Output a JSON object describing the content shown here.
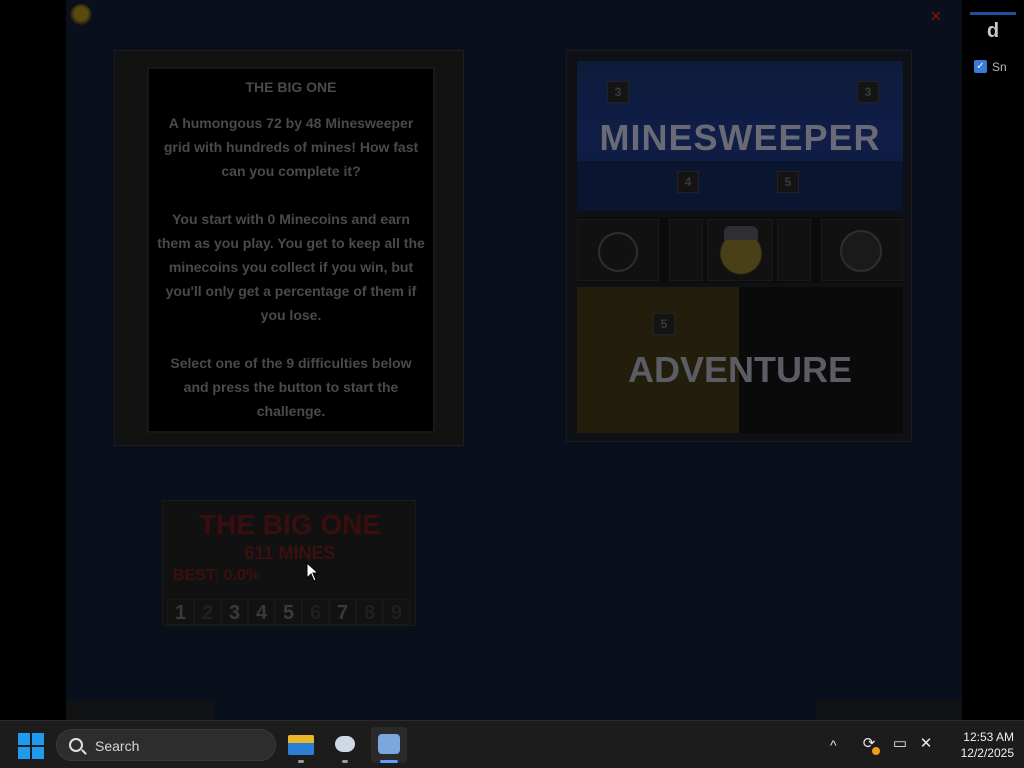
{
  "right_panel": {
    "letter": "d",
    "checkbox_label": "Sn"
  },
  "description": {
    "title": "THE BIG ONE",
    "paragraph1": "A humongous 72 by 48 Minesweeper grid with hundreds of mines! How fast can you complete it?",
    "paragraph2": "You start with 0 Minecoins and earn them as you play. You get to keep all the minecoins you collect if you win, but you'll only get a percentage of them if you lose.",
    "paragraph3": "Select one of the 9 difficulties below and press the button to start the challenge."
  },
  "title_image": {
    "title_top": "MINESWEEPER",
    "title_bottom": "ADVENTURE",
    "tile_numbers": [
      "3",
      "3",
      "4",
      "5",
      "5"
    ]
  },
  "selector": {
    "title": "THE BIG ONE",
    "mines_label": "611 MINES",
    "best_label": "BEST: 0.0%",
    "difficulties": [
      "1",
      "2",
      "3",
      "4",
      "5",
      "6",
      "7",
      "8",
      "9"
    ]
  },
  "taskbar": {
    "search_label": "Search",
    "time": "12:53 AM",
    "date": "12/2/2025"
  },
  "colors": {
    "accent": "#1e9bf0",
    "game_background": "#0a0f1c"
  }
}
